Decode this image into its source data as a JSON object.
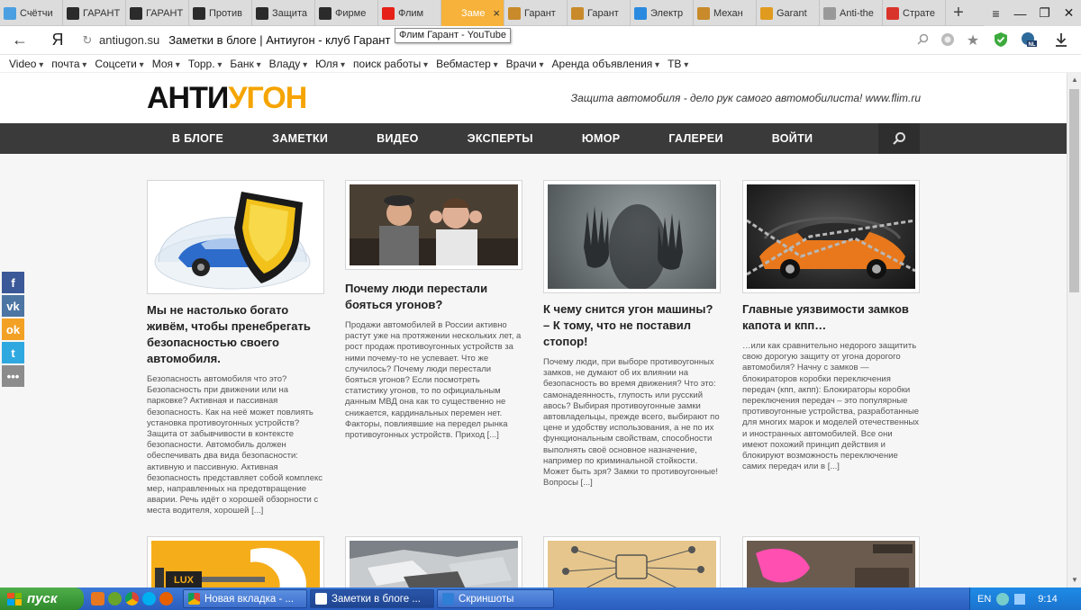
{
  "browser": {
    "tabs": [
      {
        "title": "Счётчи",
        "icon": "counter-icon",
        "color": "#4aa0e0"
      },
      {
        "title": "ГАРАНТ",
        "icon": "garant-shield-icon",
        "color": "#2b2b2b"
      },
      {
        "title": "ГАРАНТ",
        "icon": "garant-shield-icon",
        "color": "#2b2b2b"
      },
      {
        "title": "Против",
        "icon": "garant-shield-icon",
        "color": "#2b2b2b"
      },
      {
        "title": "Защита",
        "icon": "garant-shield-icon",
        "color": "#2b2b2b"
      },
      {
        "title": "Фирме",
        "icon": "garant-shield-icon",
        "color": "#2b2b2b"
      },
      {
        "title": "Флим",
        "icon": "youtube-icon",
        "color": "#e62117"
      },
      {
        "title": "Заме",
        "icon": "lock-icon",
        "color": "#f6b23a",
        "active": true
      },
      {
        "title": "Гарант",
        "icon": "key-icon",
        "color": "#c88a2a"
      },
      {
        "title": "Гарант",
        "icon": "key-icon",
        "color": "#c88a2a"
      },
      {
        "title": "Электр",
        "icon": "electro-icon",
        "color": "#2a8adf"
      },
      {
        "title": "Механ",
        "icon": "key-icon",
        "color": "#c88a2a"
      },
      {
        "title": "Garant",
        "icon": "garant-g-icon",
        "color": "#e09a1f"
      },
      {
        "title": "Anti-the",
        "icon": "antitheft-icon",
        "color": "#999999"
      },
      {
        "title": "Страте",
        "icon": "r-icon",
        "color": "#d9342b"
      }
    ],
    "tab_close": "×",
    "new_tab": "+",
    "window": {
      "menu": "≡",
      "minimize": "—",
      "maximize": "❐",
      "close": "✕"
    },
    "nav_back": "←",
    "yandex": "Я",
    "url_domain": "antiugon.su",
    "page_title": "Заметки в блоге | Антиугон - клуб Гарант",
    "tooltip": "Флим Гарант - YouTube",
    "bookmarks": [
      "Video",
      "почта",
      "Соцсети",
      "Моя",
      "Торр.",
      "Банк",
      "Владу",
      "Юля",
      "поиск работы",
      "Вебмастер",
      "Врачи",
      "Аренда объявления",
      "ТВ"
    ]
  },
  "site": {
    "logo_black": "АНТИ",
    "logo_orange": "УГОН",
    "tagline": "Защита автомобиля - дело рук самого автомобилиста! www.flim.ru",
    "nav": [
      "В БЛОГЕ",
      "ЗАМЕТКИ",
      "ВИДЕО",
      "ЭКСПЕРТЫ",
      "ЮМОР",
      "ГАЛЕРЕИ",
      "ВОЙТИ"
    ],
    "social": [
      {
        "name": "facebook",
        "glyph": "f",
        "color": "#3b5998"
      },
      {
        "name": "vkontakte",
        "glyph": "vk",
        "color": "#4c75a3"
      },
      {
        "name": "odnoklassniki",
        "glyph": "ok",
        "color": "#f2a125"
      },
      {
        "name": "twitter",
        "glyph": "t",
        "color": "#2fa8e0"
      },
      {
        "name": "more",
        "glyph": "•••",
        "color": "#8c8c8c"
      }
    ],
    "posts": [
      {
        "title": "Мы не настолько богато живём, чтобы пренебрегать безопасностью своего автомобиля.",
        "excerpt": "Безопасность автомобиля что это? Безопасность при движении или на парковке? Активная и пассивная безопасность. Как на неё может повлиять установка противоугонных устройств? Защита от забывчивости в контексте безопасности. Автомобиль должен обеспечивать два вида безопасности: активную и пассивную. Активная безопасность представляет собой комплекс мер, направленных на предотвращение аварии. Речь идёт о хорошей обзорности с места водителя, хорошей [...]"
      },
      {
        "title": "Почему люди перестали бояться угонов?",
        "excerpt": "Продажи автомобилей в России активно растут уже на протяжении нескольких лет, а рост продаж противоугонных устройств за ними почему-то не успевает. Что же случилось?  Почему люди перестали бояться угонов? Если посмотреть статистику угонов, то по официальным данным МВД она как то существенно не снижается, кардинальных перемен нет. Факторы, повлиявшие на передел рынка противоугонных устройств. Приход [...]"
      },
      {
        "title": "К чему снится угон машины? – К тому, что не поставил стопор!",
        "excerpt": "Почему люди, при выборе противоугонных замков, не думают об их влиянии на безопасность во время движения? Что это: самонадеянность, глупость или русский авось? Выбирая противоугонные замки автовладельцы, прежде всего, выбирают по цене и удобству использования, а не по их функциональным свойствам, способности выполнять своё основное назначение, например по криминальной стойкости.  Может быть зря? Замки то противоугонные! Вопросы [...]"
      },
      {
        "title": "Главные уязвимости замков капота и кпп…",
        "excerpt": "…или как сравнительно недорого защитить свою дорогую защиту от угона дорогого автомобиля? Начну с замков — блокираторов коробки переключения передач (кпп, акпп):  Блокираторы коробки переключения передач – это популярные противоугонные устройства, разработанные для многих марок и моделей отечественных и иностранных автомобилей. Все они имеют похожий принцип действия и блокируют возможность переключение самих передач или в [...]"
      }
    ],
    "second_row_label": "LUX"
  },
  "taskbar": {
    "start": "пуск",
    "tasks": [
      {
        "title": "Новая вкладка - ...",
        "icon": "chrome-icon"
      },
      {
        "title": "Заметки в блоге ...",
        "icon": "yandex-browser-icon",
        "active": true
      },
      {
        "title": "Скриншоты",
        "icon": "folder-icon"
      }
    ],
    "lang": "EN",
    "time": "9:14"
  }
}
